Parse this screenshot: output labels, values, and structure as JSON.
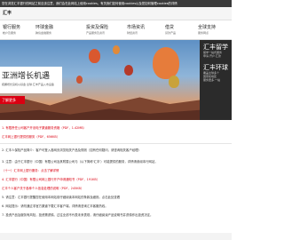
{
  "cookie_text": "您在浏览汇丰银行的网站之前应该注意，我们会在此网站上使用cookies。有关我们如何使用cookies以及您如何管理cookies的详情",
  "brand": "汇丰",
  "nav": [
    {
      "title": "银行服务",
      "sub": "帐户及服务"
    },
    {
      "title": "环球金融",
      "sub": "跨境金融服务"
    },
    {
      "title": "投资及保险",
      "sub": "产品服务及资讯"
    },
    {
      "title": "市场资讯",
      "sub": "财经资讯"
    },
    {
      "title": "借贷",
      "sub": "贷款产品"
    },
    {
      "title": "全球支持",
      "sub": "服务网点"
    }
  ],
  "hero": {
    "title": "亚洲增长机遇",
    "subtitle": "把握增长良机以基金·全球·汇丰产品入市设备",
    "button": "了解更多"
  },
  "side": [
    {
      "title": "汇丰留学",
      "lines": [
        "留学一站式服务",
        "申请·开户·汇款"
      ]
    },
    {
      "title": "汇丰环球",
      "lines": [
        "覆盖全球多个",
        "国家和地区",
        "服务更多·一站"
      ]
    }
  ],
  "content": {
    "r1": "1. 有限责任公司客户开设电子渠道服务资格（PDF，1.42MB）",
    "r2": "汇丰网上银行提供的服务（PDF，656KB）",
    "r3": "2. 汇丰人保险产品简介：客户可登入各网页浏览相关产品及规则（如有任何疑问，请咨询相关客户经理）",
    "r4": "3. 注意：由于汇丰银行（中国）有限公司及其附属公司与（以下简称'汇丰'）可能提供的服务，详情请参阅本行网站。",
    "r5": "（十一）汇丰网上银行服务：点击了解详情",
    "r6": "4. 汇丰银行（中国）有限公司网上银行开户申请通知书（PDF，191KB）",
    "r7": "汇丰个人客户关于各种个人信息处理的说明（PDF，245KB）",
    "r8": "5. 请注意：汇丰银行提醒您在使用本网站前仔细阅读本网站的条款及细则。点击此处查看",
    "r9": "6. 网站提示：请勿通过非官方渠道下载汇丰客户端，详情请咨询汇丰客服热线。",
    "r10": "7. 投资产品及服务有风险，投资需谨慎。过往业绩不代表未来表现，请仔细阅读产品说明书并谨慎作出投资决定。"
  }
}
